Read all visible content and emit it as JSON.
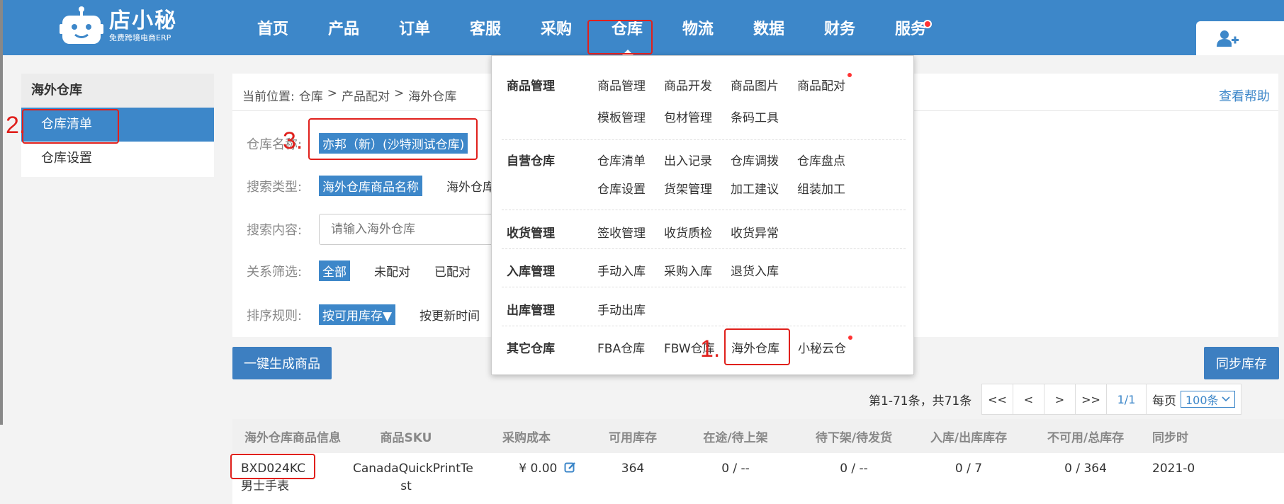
{
  "brand": {
    "name": "店小秘",
    "tagline": "免费跨境电商ERP"
  },
  "nav": [
    {
      "label": "首页"
    },
    {
      "label": "产品"
    },
    {
      "label": "订单"
    },
    {
      "label": "客服"
    },
    {
      "label": "采购"
    },
    {
      "label": "仓库"
    },
    {
      "label": "物流"
    },
    {
      "label": "数据"
    },
    {
      "label": "财务"
    },
    {
      "label": "服务"
    }
  ],
  "annotations": {
    "n1": "1.",
    "n2": "2.",
    "n3": "3."
  },
  "sidebar": {
    "title": "海外仓库",
    "items": [
      {
        "label": "仓库清单"
      },
      {
        "label": "仓库设置"
      }
    ]
  },
  "breadcrumb": {
    "prefix": "当前位置:",
    "parts": [
      "仓库",
      ">",
      "产品配对",
      ">",
      "海外仓库"
    ]
  },
  "help": "查看帮助",
  "filters": {
    "warehouse_label": "仓库名称:",
    "warehouse_value": "亦邦（新）(沙特测试仓库)",
    "search_type_label": "搜索类型:",
    "search_type_active": "海外仓库商品名称",
    "search_type_other": "海外仓库",
    "search_content_label": "搜索内容:",
    "search_placeholder": "请输入海外仓库",
    "relation_label": "关系筛选:",
    "relation_options": [
      "全部",
      "未配对",
      "已配对"
    ],
    "sort_label": "排序规则:",
    "sort_active": "按可用库存▼",
    "sort_other": "按更新时间"
  },
  "buttons": {
    "generate": "一键生成商品",
    "sync": "同步库存"
  },
  "pagination": {
    "info": "第1-71条，共71条",
    "first": "<<",
    "prev": "<",
    "next": ">",
    "last": ">>",
    "current": "1/1",
    "per_page_label": "每页",
    "per_page_value": "100条"
  },
  "table": {
    "headers": [
      "海外仓库商品信息",
      "商品SKU",
      "采购成本",
      "可用库存",
      "在途/待上架",
      "待下架/待发货",
      "入库/出库库存",
      "不可用/总库存",
      "同步时"
    ],
    "rows": [
      {
        "code": "BXD024KC",
        "name": "男士手表",
        "sku_1": "CanadaQuickPrintTe",
        "sku_2": "st",
        "cost": "¥ 0.00",
        "available": "364",
        "in_transit": "0 / --",
        "pending": "0 / --",
        "in_out": "0 / 7",
        "unavailable_total": "0 / 364",
        "sync_time": "2021-0"
      }
    ]
  },
  "dropdown": {
    "categories": [
      {
        "title": "商品管理",
        "rows": [
          [
            "商品管理",
            "商品开发",
            "商品图片",
            "商品配对"
          ],
          [
            "模板管理",
            "包材管理",
            "条码工具"
          ]
        ]
      },
      {
        "title": "自营仓库",
        "rows": [
          [
            "仓库清单",
            "出入记录",
            "仓库调拨",
            "仓库盘点"
          ],
          [
            "仓库设置",
            "货架管理",
            "加工建议",
            "组装加工"
          ]
        ]
      },
      {
        "title": "收货管理",
        "rows": [
          [
            "签收管理",
            "收货质检",
            "收货异常"
          ]
        ]
      },
      {
        "title": "入库管理",
        "rows": [
          [
            "手动入库",
            "采购入库",
            "退货入库"
          ]
        ]
      },
      {
        "title": "出库管理",
        "rows": [
          [
            "手动出库"
          ]
        ]
      },
      {
        "title": "其它仓库",
        "rows": [
          [
            "FBA仓库",
            "FBW仓库",
            "海外仓库",
            "小秘云仓"
          ]
        ]
      }
    ]
  },
  "colors": {
    "primary": "#3d87c9",
    "annotation": "#e0201c",
    "badge": "#ff3333"
  }
}
